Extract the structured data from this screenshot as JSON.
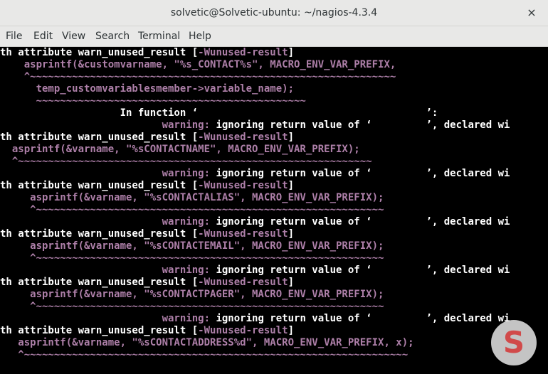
{
  "window": {
    "title": "solvetic@Solvetic-ubuntu: ~/nagios-4.3.4",
    "close_glyph": "×"
  },
  "menu": [
    {
      "label": "File"
    },
    {
      "label": "Edit"
    },
    {
      "label": "View"
    },
    {
      "label": "Search"
    },
    {
      "label": "Terminal"
    },
    {
      "label": "Help"
    }
  ],
  "terminal_lines": [
    {
      "segments": [
        [
          "th attribute warn_unused_result [",
          "white"
        ],
        [
          "-Wunused-result",
          "warn"
        ],
        [
          "]",
          "white"
        ]
      ]
    },
    {
      "segments": [
        [
          "    asprintf(&customvarname, \"%s_CONTACT%s\", MACRO_ENV_VAR_PREFIX,",
          "code"
        ]
      ]
    },
    {
      "segments": [
        [
          "    ^~~~~~~~~~~~~~~~~~~~~~~~~~~~~~~~~~~~~~~~~~~~~~~~~~~~~~~~~~~~~~",
          "tilde"
        ]
      ]
    },
    {
      "segments": [
        [
          "      temp_customvariablesmember->variable_name);",
          "code"
        ]
      ]
    },
    {
      "segments": [
        [
          "      ~~~~~~~~~~~~~~~~~~~~~~~~~~~~~~~~~~~~~~~~~~~~~",
          "tilde"
        ]
      ]
    },
    {
      "segments": [
        [
          "                    In function ‘                                      ’:",
          "white"
        ]
      ]
    },
    {
      "segments": [
        [
          "                           ",
          "white"
        ],
        [
          "warning:",
          "warn"
        ],
        [
          " ignoring return value of ‘         ’, declared wi",
          "white"
        ]
      ]
    },
    {
      "segments": [
        [
          "th attribute warn_unused_result [",
          "white"
        ],
        [
          "-Wunused-result",
          "warn"
        ],
        [
          "]",
          "white"
        ]
      ]
    },
    {
      "segments": [
        [
          "  asprintf(&varname, \"%sCONTACTNAME\", MACRO_ENV_VAR_PREFIX);",
          "code"
        ]
      ]
    },
    {
      "segments": [
        [
          "  ^~~~~~~~~~~~~~~~~~~~~~~~~~~~~~~~~~~~~~~~~~~~~~~~~~~~~~~~~~~~",
          "tilde"
        ]
      ]
    },
    {
      "segments": [
        [
          "                           ",
          "white"
        ],
        [
          "warning:",
          "warn"
        ],
        [
          " ignoring return value of ‘         ’, declared wi",
          "white"
        ]
      ]
    },
    {
      "segments": [
        [
          "th attribute warn_unused_result [",
          "white"
        ],
        [
          "-Wunused-result",
          "warn"
        ],
        [
          "]",
          "white"
        ]
      ]
    },
    {
      "segments": [
        [
          "     asprintf(&varname, \"%sCONTACTALIAS\", MACRO_ENV_VAR_PREFIX);",
          "code"
        ]
      ]
    },
    {
      "segments": [
        [
          "     ^~~~~~~~~~~~~~~~~~~~~~~~~~~~~~~~~~~~~~~~~~~~~~~~~~~~~~~~~~~",
          "tilde"
        ]
      ]
    },
    {
      "segments": [
        [
          "                           ",
          "white"
        ],
        [
          "warning:",
          "warn"
        ],
        [
          " ignoring return value of ‘         ’, declared wi",
          "white"
        ]
      ]
    },
    {
      "segments": [
        [
          "th attribute warn_unused_result [",
          "white"
        ],
        [
          "-Wunused-result",
          "warn"
        ],
        [
          "]",
          "white"
        ]
      ]
    },
    {
      "segments": [
        [
          "     asprintf(&varname, \"%sCONTACTEMAIL\", MACRO_ENV_VAR_PREFIX);",
          "code"
        ]
      ]
    },
    {
      "segments": [
        [
          "     ^~~~~~~~~~~~~~~~~~~~~~~~~~~~~~~~~~~~~~~~~~~~~~~~~~~~~~~~~~~",
          "tilde"
        ]
      ]
    },
    {
      "segments": [
        [
          "                           ",
          "white"
        ],
        [
          "warning:",
          "warn"
        ],
        [
          " ignoring return value of ‘         ’, declared wi",
          "white"
        ]
      ]
    },
    {
      "segments": [
        [
          "th attribute warn_unused_result [",
          "white"
        ],
        [
          "-Wunused-result",
          "warn"
        ],
        [
          "]",
          "white"
        ]
      ]
    },
    {
      "segments": [
        [
          "     asprintf(&varname, \"%sCONTACTPAGER\", MACRO_ENV_VAR_PREFIX);",
          "code"
        ]
      ]
    },
    {
      "segments": [
        [
          "     ^~~~~~~~~~~~~~~~~~~~~~~~~~~~~~~~~~~~~~~~~~~~~~~~~~~~~~~~~~~",
          "tilde"
        ]
      ]
    },
    {
      "segments": [
        [
          "                           ",
          "white"
        ],
        [
          "warning:",
          "warn"
        ],
        [
          " ignoring return value of ‘         ’, declared wi",
          "white"
        ]
      ]
    },
    {
      "segments": [
        [
          "th attribute warn_unused_result [",
          "white"
        ],
        [
          "-Wunused-result",
          "warn"
        ],
        [
          "]",
          "white"
        ]
      ]
    },
    {
      "segments": [
        [
          "   asprintf(&varname, \"%sCONTACTADDRESS%d\", MACRO_ENV_VAR_PREFIX, x);",
          "code"
        ]
      ]
    },
    {
      "segments": [
        [
          "   ^~~~~~~~~~~~~~~~~~~~~~~~~~~~~~~~~~~~~~~~~~~~~~~~~~~~~~~~~~~~~~~~~",
          "tilde"
        ]
      ]
    }
  ],
  "watermark": {
    "glyph": "S"
  },
  "colors": {
    "background": "#000000",
    "text": "#ffffff",
    "warning": "#ad7fa8",
    "chrome": "#e8e8e7"
  }
}
